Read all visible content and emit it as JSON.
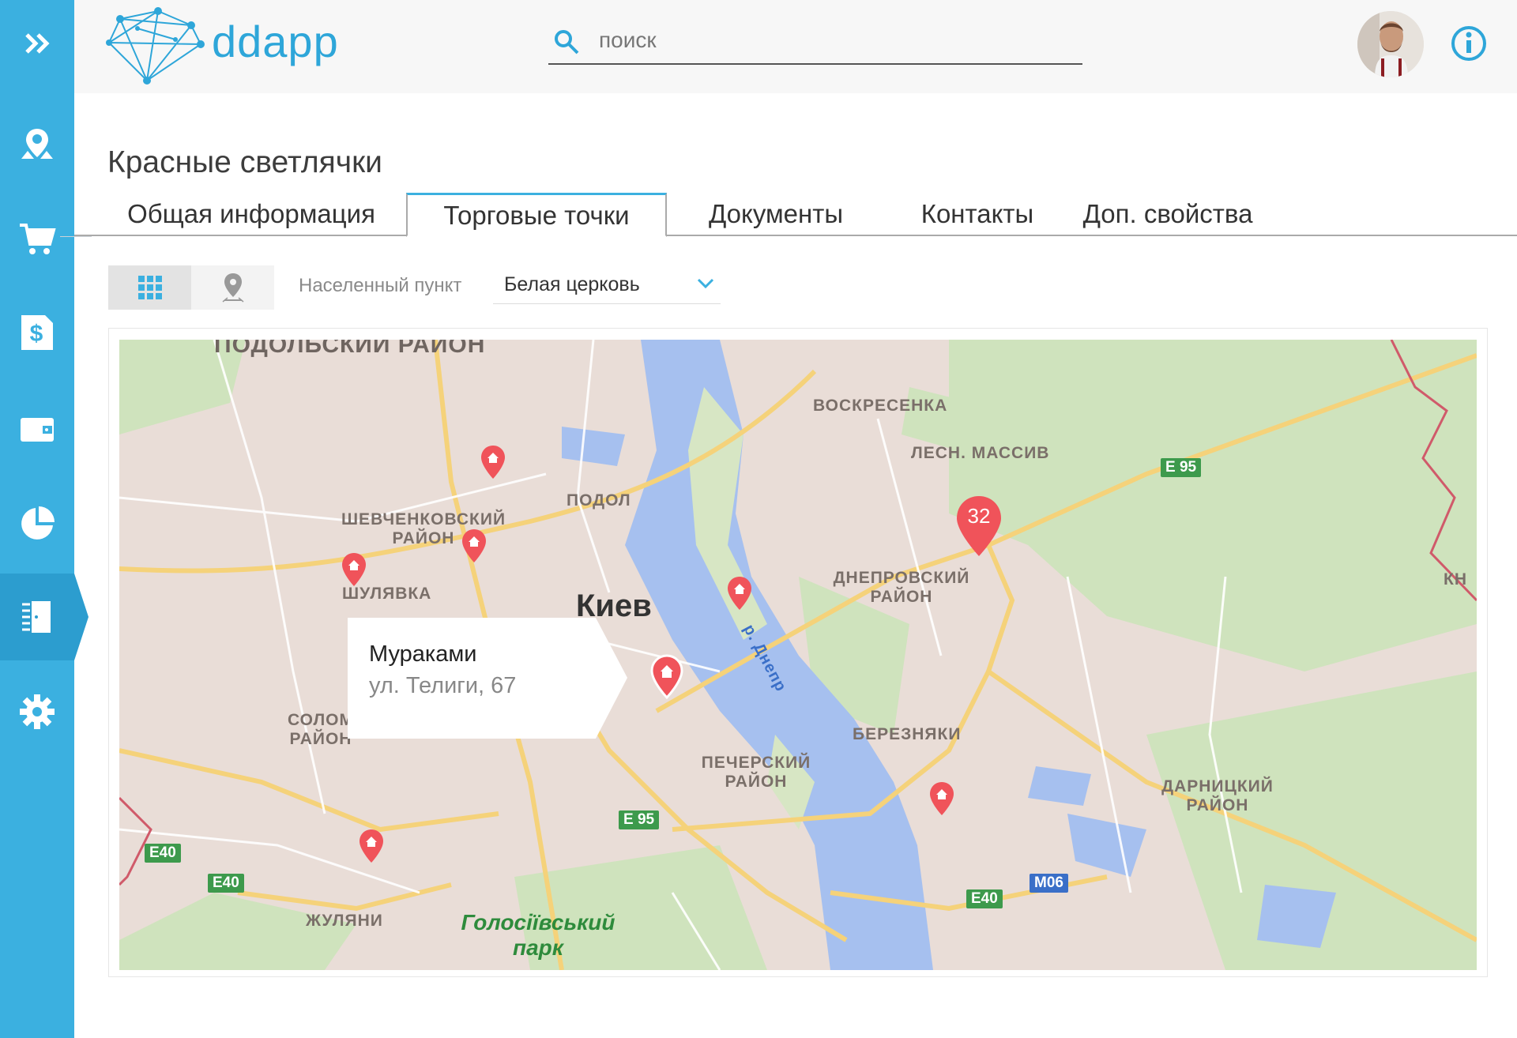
{
  "app": {
    "logo_text": "ddapp"
  },
  "search": {
    "placeholder": "поиск"
  },
  "page": {
    "title": "Красные светлячки"
  },
  "tabs": [
    {
      "label": "Общая информация"
    },
    {
      "label": "Торговые точки"
    },
    {
      "label": "Документы"
    },
    {
      "label": "Контакты"
    },
    {
      "label": "Доп. свойства"
    }
  ],
  "filters": {
    "city_label": "Населенный пункт",
    "city_value": "Белая церковь"
  },
  "map": {
    "labels": {
      "podolsky": "ПОДОЛЬСКИЙ РАЙОН",
      "voskresenka": "ВОСКРЕСЕНКА",
      "lesn": "ЛЕСН. МАССИВ",
      "shevchenko": "ШЕВЧЕНКОВСКИЙ РАЙОН",
      "podol": "ПОДОЛ",
      "shulyavka": "ШУЛЯВКА",
      "kiev": "Киев",
      "dnepr_district": "ДНЕПРОВСКИЙ РАЙОН",
      "river": "р. Днепр",
      "solom": "СОЛОМ РАЙОН",
      "bereznyaki": "БЕРЕЗНЯКИ",
      "pechersk": "ПЕЧЕРСКИЙ РАЙОН",
      "darnitsa": "ДАРНИЦКИЙ РАЙОН",
      "zhulyany": "ЖУЛЯНИ",
      "park": "Голосіївський парк",
      "kn": "Кн"
    },
    "shields": {
      "e95_a": "E 95",
      "e95_b": "E 95",
      "e40_a": "E40",
      "e40_b": "E40",
      "e40_c": "E40",
      "m06": "M06"
    },
    "cluster_count": "32",
    "tooltip": {
      "name": "Мураками",
      "address": "ул. Телиги, 67"
    }
  },
  "colors": {
    "accent": "#3bb0e0",
    "marker": "#f0535a"
  },
  "icons": {
    "sidebar": [
      "double-chevron-right-icon",
      "map-pin-icon",
      "cart-icon",
      "dollar-document-icon",
      "wallet-icon",
      "pie-chart-icon",
      "door-icon",
      "gear-icon"
    ],
    "search": "search-icon",
    "info": "info-icon",
    "grid": "grid-icon",
    "map": "map-marker-icon"
  }
}
